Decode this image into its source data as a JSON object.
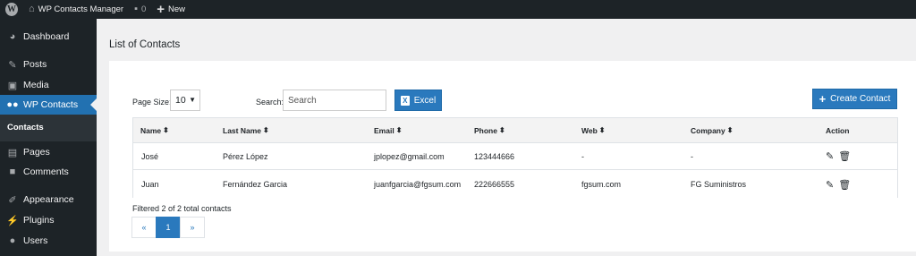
{
  "adminbar": {
    "site_name": "WP Contacts Manager",
    "comments_count": "0",
    "new_label": "New"
  },
  "sidebar": {
    "items": [
      {
        "label": "Dashboard",
        "icon": "dashboard-icon"
      },
      {
        "label": "Posts",
        "icon": "pin-icon"
      },
      {
        "label": "Media",
        "icon": "media-icon"
      },
      {
        "label": "WP Contacts",
        "icon": "users-icon"
      },
      {
        "label": "Pages",
        "icon": "page-icon"
      },
      {
        "label": "Comments",
        "icon": "comment-icon"
      },
      {
        "label": "Appearance",
        "icon": "brush-icon"
      },
      {
        "label": "Plugins",
        "icon": "plug-icon"
      },
      {
        "label": "Users",
        "icon": "user-icon"
      }
    ],
    "submenu": {
      "label": "Contacts"
    }
  },
  "main": {
    "title": "List of Contacts",
    "page_size_label": "Page Size:",
    "page_size_value": "10",
    "search_label": "Search:",
    "search_placeholder": "Search",
    "excel_label": "Excel",
    "create_label": "Create Contact"
  },
  "table": {
    "headers": [
      "Name",
      "Last Name",
      "Email",
      "Phone",
      "Web",
      "Company",
      "Action"
    ],
    "rows": [
      {
        "name": "José",
        "last_name": "Pérez López",
        "email": "jplopez@gmail.com",
        "phone": "123444666",
        "web": "-",
        "company": "-"
      },
      {
        "name": "Juan",
        "last_name": "Fernández Garcia",
        "email": "juanfgarcia@fgsum.com",
        "phone": "222666555",
        "web": "fgsum.com",
        "company": "FG Suministros"
      }
    ]
  },
  "footer": {
    "filtered_text": "Filtered 2 of 2 total contacts",
    "pager": {
      "prev": "«",
      "current": "1",
      "next": "»"
    }
  },
  "colors": {
    "accent": "#2a79bd",
    "wp_admin_blue": "#2271b1",
    "admin_dark": "#1d2327"
  }
}
